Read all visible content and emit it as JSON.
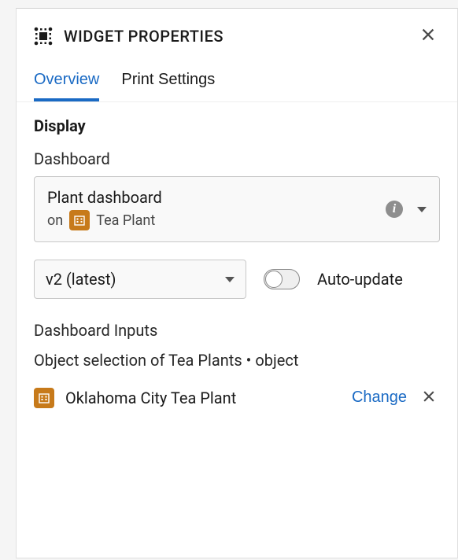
{
  "panel": {
    "title": "WIDGET PROPERTIES"
  },
  "tabs": {
    "overview": "Overview",
    "print_settings": "Print Settings"
  },
  "display": {
    "section_title": "Display",
    "dashboard_label": "Dashboard",
    "dashboard_card": {
      "name": "Plant dashboard",
      "on_prefix": "on",
      "type_name": "Tea Plant"
    },
    "version_select": "v2 (latest)",
    "auto_update_label": "Auto-update",
    "auto_update_on": false
  },
  "inputs": {
    "section_title": "Dashboard Inputs",
    "param_label": "Object selection of Tea Plants • object",
    "selected_value": "Oklahoma City Tea Plant",
    "change_label": "Change"
  }
}
